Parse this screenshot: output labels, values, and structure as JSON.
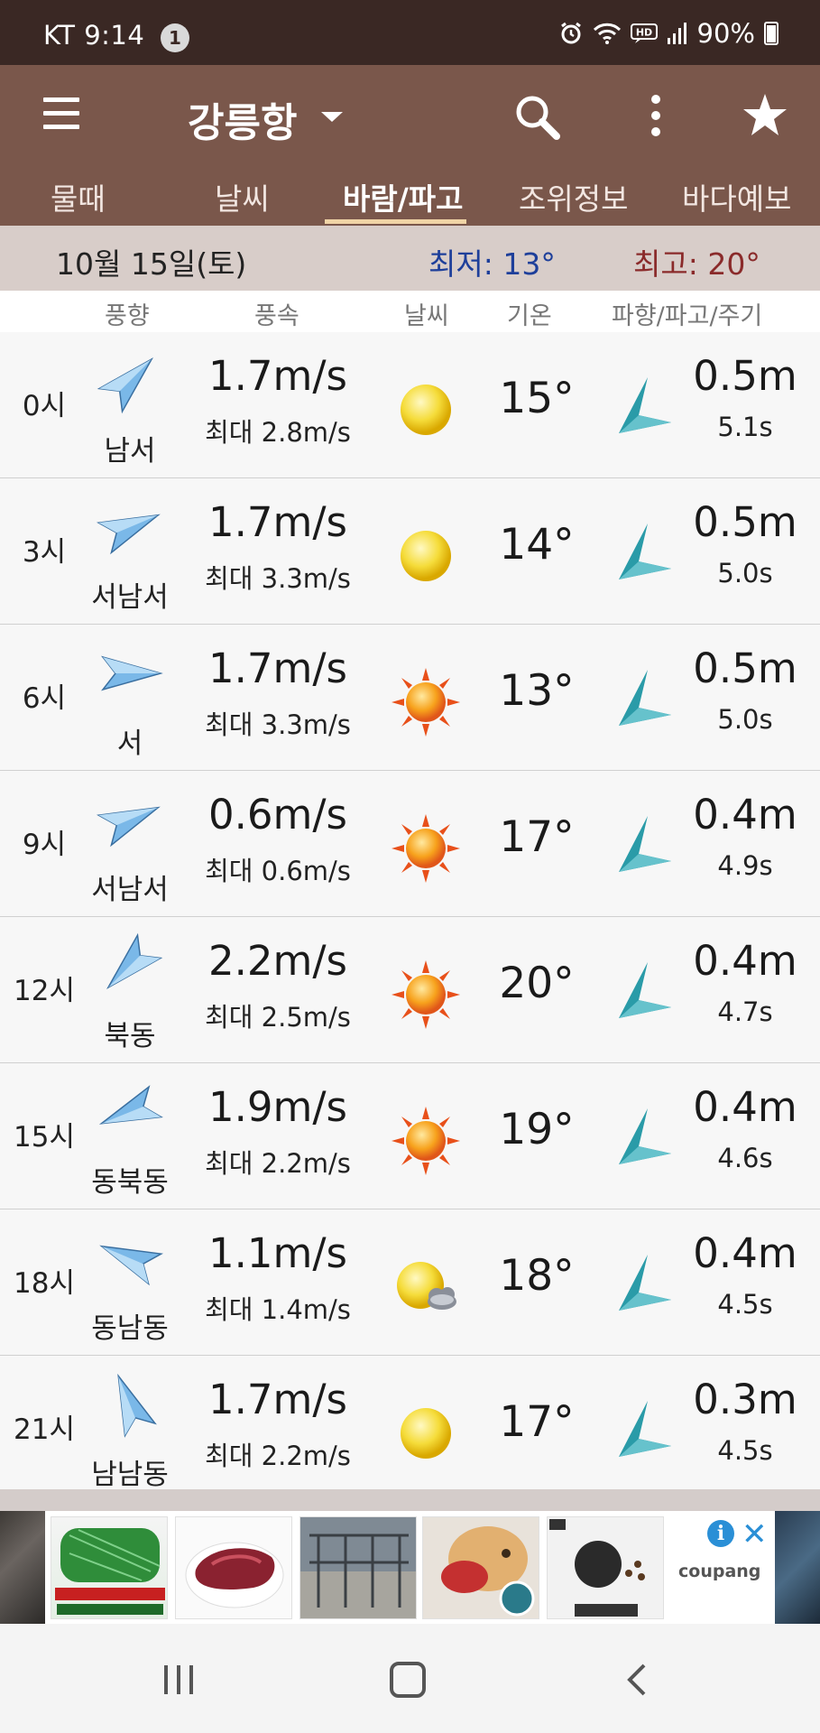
{
  "status_bar": {
    "carrier": "KT",
    "time": "9:14",
    "notification_count": "1",
    "battery": "90%",
    "icons": [
      "alarm-icon",
      "wifi-icon",
      "hd-voice-icon",
      "signal-icon",
      "battery-icon"
    ]
  },
  "app_bar": {
    "title": "강릉항",
    "icons": [
      "menu-icon",
      "dropdown-caret-icon",
      "search-icon",
      "more-vert-icon",
      "star-icon"
    ]
  },
  "tabs": [
    {
      "label": "물때",
      "active": false
    },
    {
      "label": "날씨",
      "active": false
    },
    {
      "label": "바람/파고",
      "active": true
    },
    {
      "label": "조위정보",
      "active": false
    },
    {
      "label": "바다예보",
      "active": false
    }
  ],
  "date_bar": {
    "date": "10월 15일(토)",
    "min_temp": "최저: 13°",
    "max_temp": "최고: 20°"
  },
  "column_headers": {
    "wind_direction": "풍향",
    "wind_speed": "풍속",
    "weather": "날씨",
    "temperature": "기온",
    "wave": "파향/파고/주기"
  },
  "rows": [
    {
      "hour": "0시",
      "wind_dir": "남서",
      "speed": "1.7m/s",
      "max_speed": "최대 2.8m/s",
      "weather": "sunny",
      "temp": "15°",
      "wave_height": "0.5m",
      "period": "5.1s"
    },
    {
      "hour": "3시",
      "wind_dir": "서남서",
      "speed": "1.7m/s",
      "max_speed": "최대 3.3m/s",
      "weather": "sunny",
      "temp": "14°",
      "wave_height": "0.5m",
      "period": "5.0s"
    },
    {
      "hour": "6시",
      "wind_dir": "서",
      "speed": "1.7m/s",
      "max_speed": "최대 3.3m/s",
      "weather": "bright-sun",
      "temp": "13°",
      "wave_height": "0.5m",
      "period": "5.0s"
    },
    {
      "hour": "9시",
      "wind_dir": "서남서",
      "speed": "0.6m/s",
      "max_speed": "최대 0.6m/s",
      "weather": "bright-sun",
      "temp": "17°",
      "wave_height": "0.4m",
      "period": "4.9s"
    },
    {
      "hour": "12시",
      "wind_dir": "북동",
      "speed": "2.2m/s",
      "max_speed": "최대 2.5m/s",
      "weather": "bright-sun",
      "temp": "20°",
      "wave_height": "0.4m",
      "period": "4.7s"
    },
    {
      "hour": "15시",
      "wind_dir": "동북동",
      "speed": "1.9m/s",
      "max_speed": "최대 2.2m/s",
      "weather": "bright-sun",
      "temp": "19°",
      "wave_height": "0.4m",
      "period": "4.6s"
    },
    {
      "hour": "18시",
      "wind_dir": "동남동",
      "speed": "1.1m/s",
      "max_speed": "최대 1.4m/s",
      "weather": "partly-cloudy",
      "temp": "18°",
      "wave_height": "0.4m",
      "period": "4.5s"
    },
    {
      "hour": "21시",
      "wind_dir": "남남동",
      "speed": "1.7m/s",
      "max_speed": "최대 2.2m/s",
      "weather": "sunny",
      "temp": "17°",
      "wave_height": "0.3m",
      "period": "4.5s"
    }
  ],
  "ad": {
    "brand": "coupang",
    "info_icon": "i",
    "close_icon": "✕"
  },
  "nav_bar": {
    "icons": [
      "recent-apps-icon",
      "home-icon",
      "back-icon"
    ]
  }
}
